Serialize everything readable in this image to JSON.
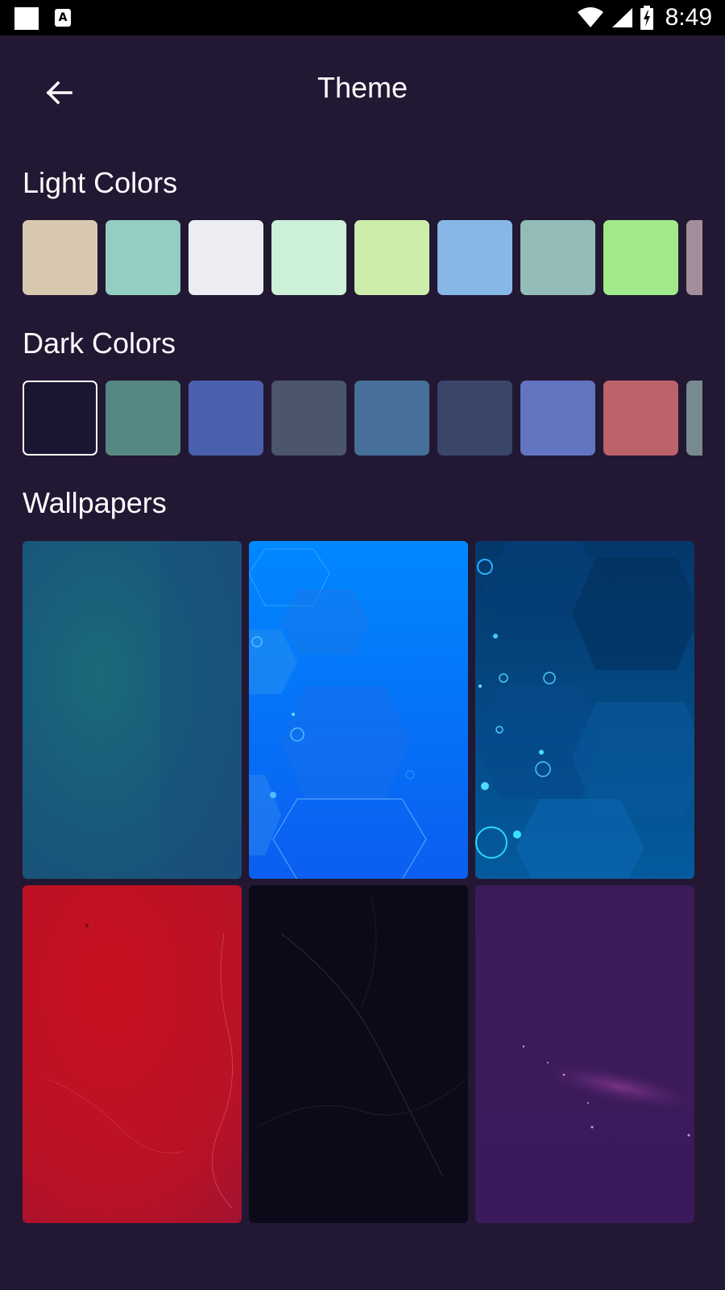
{
  "status_bar": {
    "time": "8:49",
    "icons": [
      "notification-square-icon",
      "a-badge-icon",
      "wifi-icon",
      "cell-signal-icon",
      "battery-charging-icon"
    ]
  },
  "header": {
    "title": "Theme",
    "back_icon": "arrow-left-icon"
  },
  "light_colors": {
    "title": "Light Colors",
    "swatches": [
      "#d8c8b0",
      "#94cdc1",
      "#ebedf3",
      "#cdf0d8",
      "#cdeeab",
      "#87b7e7",
      "#93bbb7",
      "#a2e98a",
      "#a58e9b"
    ]
  },
  "dark_colors": {
    "title": "Dark Colors",
    "selected_index": 0,
    "swatches": [
      "#1b1631",
      "#568883",
      "#4a5fad",
      "#4c566a",
      "#46709a",
      "#39466a",
      "#6374c1",
      "#bc626b",
      "#78898f"
    ]
  },
  "wallpapers": {
    "title": "Wallpapers",
    "items": [
      {
        "name": "teal-gradient"
      },
      {
        "name": "blue-hexagon"
      },
      {
        "name": "dark-blue-hexagon-bokeh"
      },
      {
        "name": "red-texture"
      },
      {
        "name": "black-texture"
      },
      {
        "name": "purple-nebula"
      }
    ]
  },
  "colors": {
    "background": "#221833",
    "status_bar": "#000000",
    "text": "#ffffff"
  }
}
